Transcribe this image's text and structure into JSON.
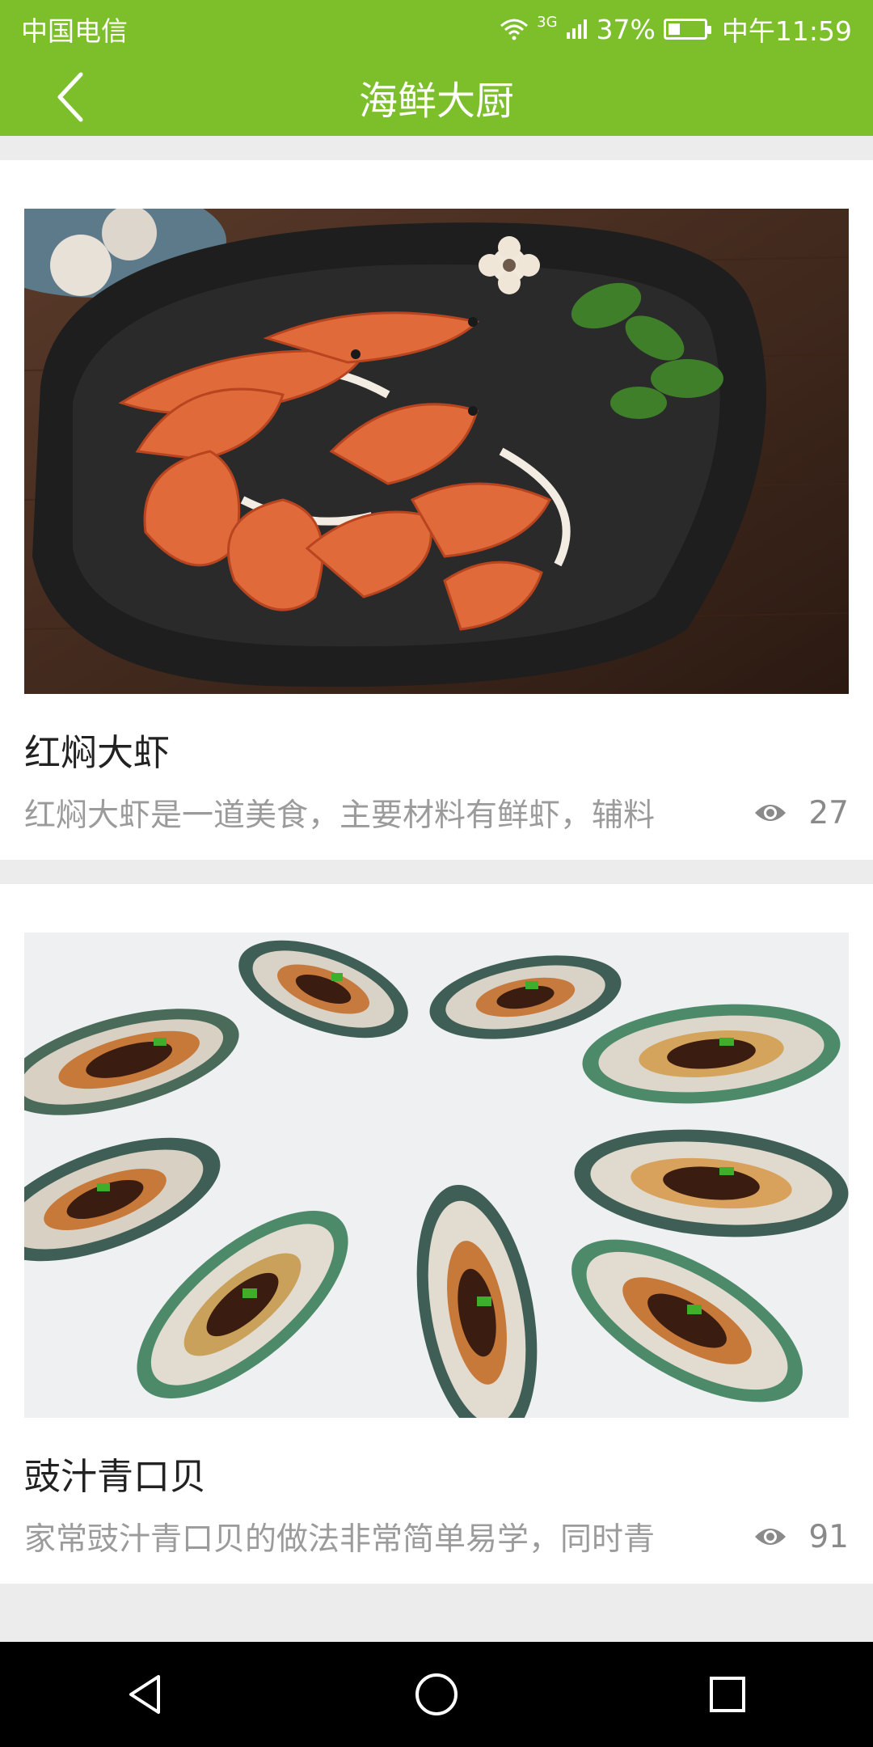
{
  "status": {
    "carrier": "中国电信",
    "network": "3G",
    "battery": "37%",
    "time": "中午11:59"
  },
  "header": {
    "title": "海鲜大厨",
    "back_icon": "chevron-left-icon"
  },
  "colors": {
    "brand": "#7cbf2b",
    "text_primary": "#222222",
    "text_secondary": "#9b9b9b",
    "background": "#ececec"
  },
  "items": [
    {
      "title": "红焖大虾",
      "desc": "红焖大虾是一道美食，主要材料有鲜虾，辅料",
      "views": "27",
      "image": "braised-shrimp-photo"
    },
    {
      "title": "豉汁青口贝",
      "desc": "家常豉汁青口贝的做法非常简单易学，同时青",
      "views": "91",
      "image": "mussels-black-bean-sauce-photo"
    }
  ],
  "navbar": {
    "back": "triangle-back-icon",
    "home": "circle-home-icon",
    "recent": "square-recent-icon"
  }
}
